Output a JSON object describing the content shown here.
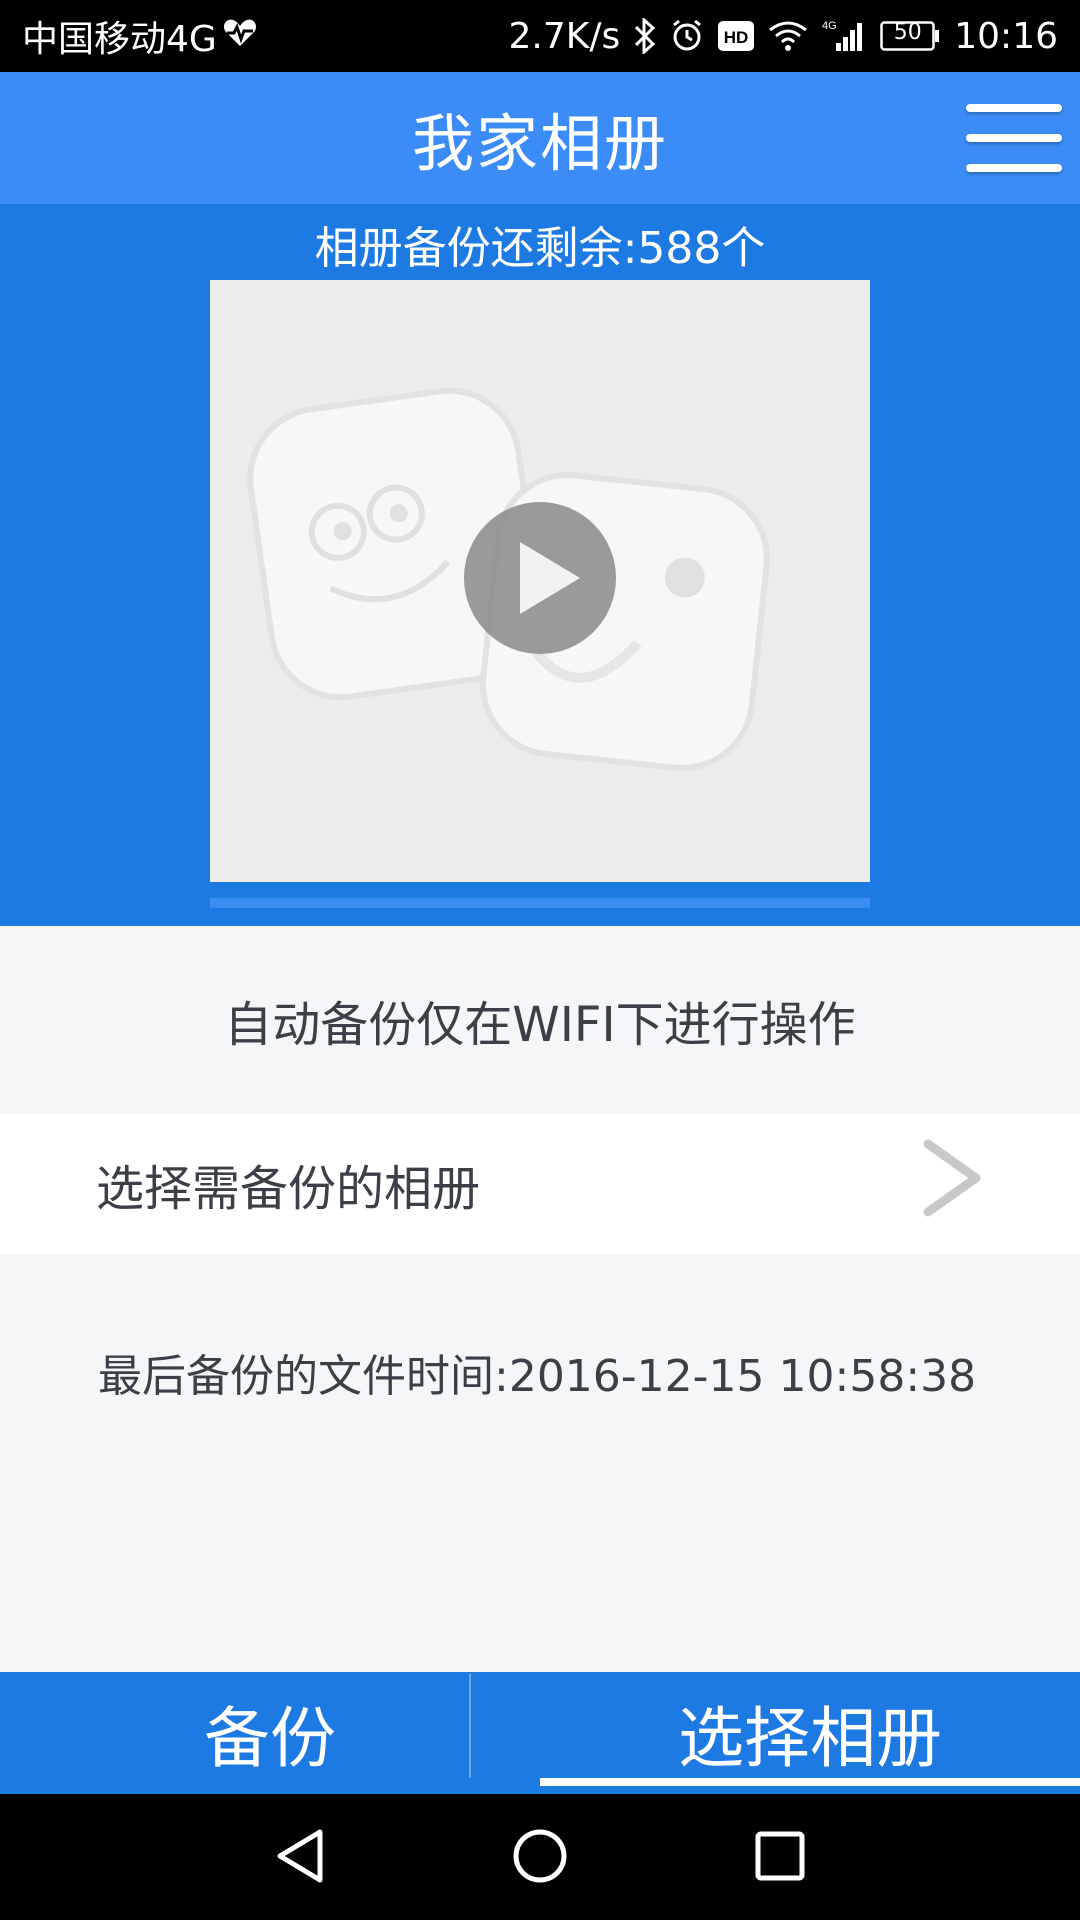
{
  "status_bar": {
    "carrier": "中国移动4G",
    "network_speed": "2.7K/s",
    "battery": "50",
    "time": "10:16",
    "icons": [
      "heart-icon",
      "bluetooth-icon",
      "alarm-icon",
      "hd-icon",
      "wifi-icon",
      "signal-4g-icon",
      "battery-icon"
    ]
  },
  "header": {
    "title": "我家相册",
    "menu_icon": "hamburger-menu-icon"
  },
  "backup": {
    "remaining_text": "相册备份还剩余:588个",
    "preview_icon": "video-play-icon",
    "wifi_notice": "自动备份仅在WIFI下进行操作",
    "select_album_label": "选择需备份的相册",
    "last_backup_time": "最后备份的文件时间:2016-12-15 10:58:38"
  },
  "tabs": [
    {
      "label": "备份",
      "active": false
    },
    {
      "label": "选择相册",
      "active": true
    }
  ],
  "nav": {
    "back_icon": "back-triangle-icon",
    "home_icon": "home-circle-icon",
    "recents_icon": "recents-square-icon"
  },
  "colors": {
    "title_bar": "#3b8cf6",
    "primary_blue": "#1e7ae3",
    "background": "#f5f6f8",
    "text_dark": "#3b3f48"
  }
}
